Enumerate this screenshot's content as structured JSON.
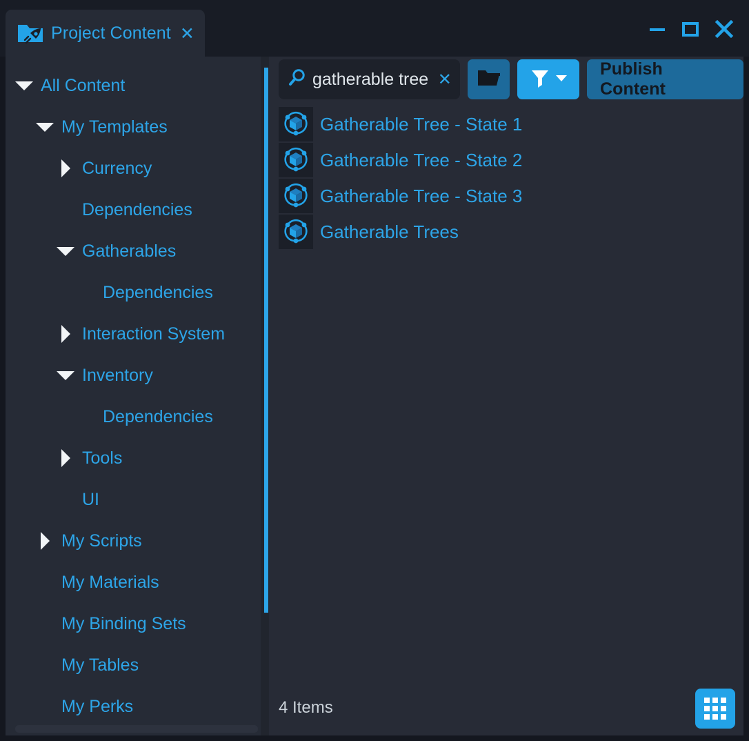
{
  "window": {
    "tab_title": "Project Content",
    "tab_icon": "folder-rocket-icon",
    "tab_close_label": "✕",
    "controls": {
      "minimize": "minimize-icon",
      "maximize": "maximize-icon",
      "close": "close-icon"
    }
  },
  "colors": {
    "accent": "#2da5e8",
    "accent_button": "#23a3e8",
    "accent_dim": "#1d6a9b",
    "panel_bg": "#262b36",
    "titlebar_bg": "#181c25",
    "search_bg": "#1d212a",
    "icon_tile_bg": "#1b1f28"
  },
  "sidebar": {
    "items": [
      {
        "label": "All Content",
        "indent": 0,
        "state": "expanded"
      },
      {
        "label": "My Templates",
        "indent": 1,
        "state": "expanded"
      },
      {
        "label": "Currency",
        "indent": 2,
        "state": "collapsed"
      },
      {
        "label": "Dependencies",
        "indent": 2,
        "state": "leaf"
      },
      {
        "label": "Gatherables",
        "indent": 2,
        "state": "expanded"
      },
      {
        "label": "Dependencies",
        "indent": 3,
        "state": "leaf"
      },
      {
        "label": "Interaction System",
        "indent": 2,
        "state": "collapsed"
      },
      {
        "label": "Inventory",
        "indent": 2,
        "state": "expanded"
      },
      {
        "label": "Dependencies",
        "indent": 3,
        "state": "leaf"
      },
      {
        "label": "Tools",
        "indent": 2,
        "state": "collapsed"
      },
      {
        "label": "UI",
        "indent": 2,
        "state": "leaf"
      },
      {
        "label": "My Scripts",
        "indent": 1,
        "state": "collapsed"
      },
      {
        "label": "My Materials",
        "indent": 1,
        "state": "leaf"
      },
      {
        "label": "My Binding Sets",
        "indent": 1,
        "state": "leaf"
      },
      {
        "label": "My Tables",
        "indent": 1,
        "state": "leaf"
      },
      {
        "label": "My Perks",
        "indent": 1,
        "state": "leaf"
      }
    ]
  },
  "toolbar": {
    "search": {
      "value": "gatherable tree",
      "placeholder": "Search",
      "icon": "magnifier-icon",
      "clear_label": "✕"
    },
    "folder_button": {
      "icon": "open-folder-icon",
      "label": ""
    },
    "filter_button": {
      "icon": "filter-funnel-icon",
      "dropdown_icon": "chevron-down-icon"
    },
    "publish_button": {
      "label": "Publish Content"
    }
  },
  "content": {
    "items": [
      {
        "label": "Gatherable Tree - State 1",
        "icon": "template-cube-icon"
      },
      {
        "label": "Gatherable Tree - State 2",
        "icon": "template-cube-icon"
      },
      {
        "label": "Gatherable Tree - State 3",
        "icon": "template-cube-icon"
      },
      {
        "label": "Gatherable Trees",
        "icon": "template-cube-icon"
      }
    ]
  },
  "statusbar": {
    "count_text": "4 Items",
    "view_mode_button": {
      "icon": "grid-view-icon"
    }
  }
}
